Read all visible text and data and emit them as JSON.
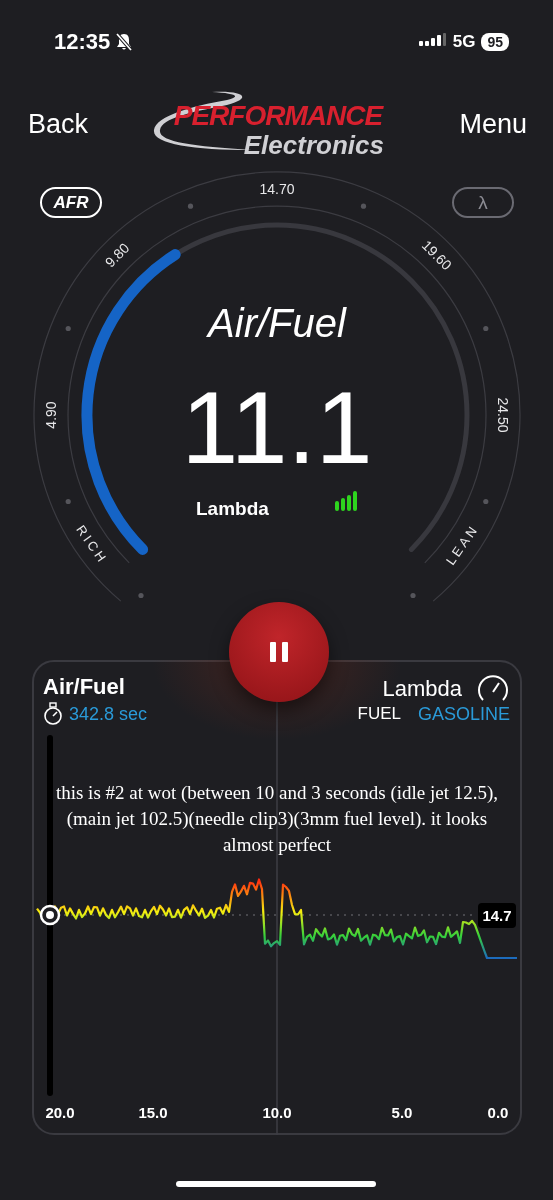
{
  "status_bar": {
    "time": "12:35",
    "silent": true,
    "network": "5G",
    "battery": "95"
  },
  "header": {
    "back": "Back",
    "menu": "Menu",
    "logo_line_1": "PERFORMANCE",
    "logo_line_2": "Electronics"
  },
  "units": [
    {
      "label": "AFR",
      "selected": true
    },
    {
      "label": "λ",
      "selected": false
    }
  ],
  "gauge": {
    "scale": [
      "4.90",
      "9.80",
      "14.70",
      "19.60",
      "24.50"
    ],
    "rich": "RICH",
    "lean": "LEAN",
    "title": "Air/Fuel",
    "value": "11.1",
    "subtitle": "Lambda"
  },
  "log": {
    "title": "Air/Fuel",
    "elapsed": "342.8 sec",
    "mode": "Lambda",
    "fuel_label": "FUEL",
    "fuel": "GASOLINE",
    "note": "this is #2 at wot (between 10 and 3 seconds (idle jet 12.5),(main jet 102.5)(needle clip3)(3mm fuel level). it looks almost perfect",
    "reference": "14.7",
    "x_ticks": [
      "20.0",
      "15.0",
      "10.0",
      "5.0",
      "0.0"
    ]
  }
}
